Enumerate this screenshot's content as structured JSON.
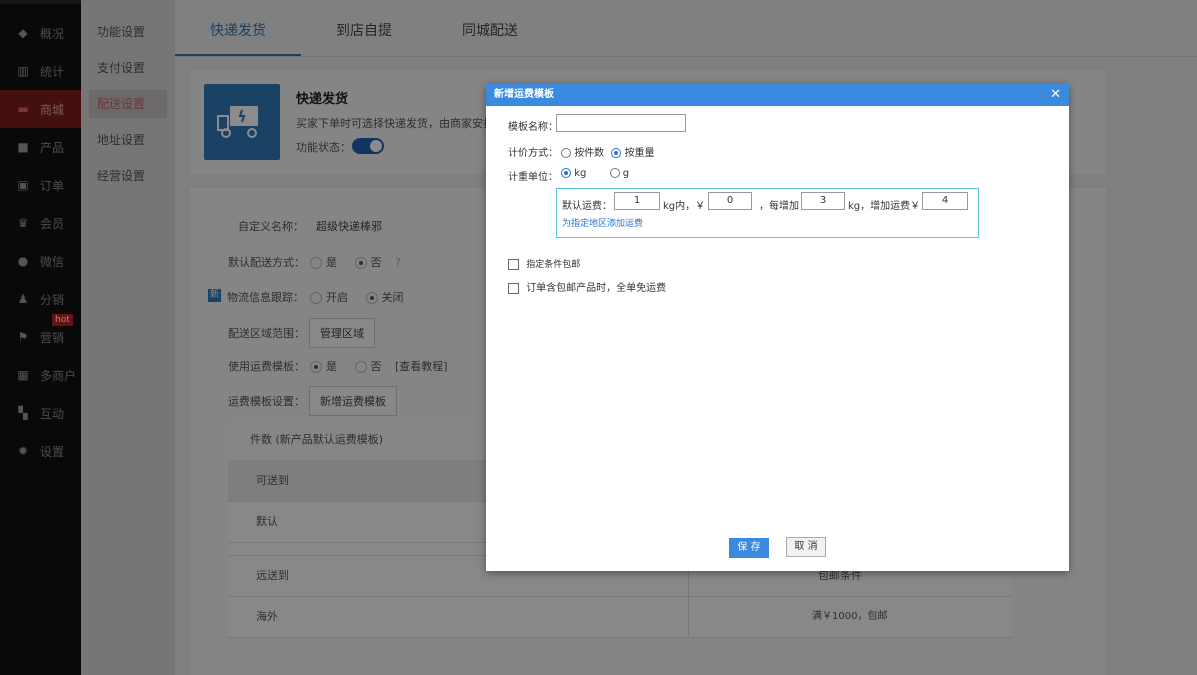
{
  "sidebar": {
    "items": [
      {
        "label": "概况",
        "icon": "graduation-icon"
      },
      {
        "label": "统计",
        "icon": "chart-icon"
      },
      {
        "label": "商城",
        "icon": "store-icon"
      },
      {
        "label": "产品",
        "icon": "grid-icon"
      },
      {
        "label": "订单",
        "icon": "order-icon"
      },
      {
        "label": "会员",
        "icon": "crown-icon"
      },
      {
        "label": "微信",
        "icon": "wechat-icon"
      },
      {
        "label": "分销",
        "icon": "users-icon"
      },
      {
        "label": "营销",
        "icon": "flag-icon",
        "badge": "hot"
      },
      {
        "label": "多商户",
        "icon": "merchant-icon"
      },
      {
        "label": "互动",
        "icon": "interact-icon"
      },
      {
        "label": "设置",
        "icon": "gear-icon"
      }
    ]
  },
  "subnav": {
    "items": [
      "功能设置",
      "支付设置",
      "配送设置",
      "地址设置",
      "经营设置"
    ]
  },
  "tabs": [
    "快递发货",
    "到店自提",
    "同城配送"
  ],
  "express": {
    "title": "快递发货",
    "desc": "买家下单时可选择快递发货，由商家安排",
    "status_label": "功能状态："
  },
  "form": {
    "custom_name_label": "自定义名称：",
    "custom_name_value": "超级快递棒邪",
    "default_method_label": "默认配送方式：",
    "yes": "是",
    "no": "否",
    "tracking_badge": "新",
    "tracking_label": "物流信息跟踪：",
    "open": "开启",
    "close": "关闭",
    "area_label": "配送区域范围：",
    "area_button": "管理区域",
    "use_template_label": "使用运费模板：",
    "tutorial_link": "[查看教程]",
    "template_setting_label": "运费模板设置：",
    "add_template_button": "新增运费模板"
  },
  "table": {
    "header": "件数 (新产品默认运费模板)",
    "rows": [
      {
        "left": "可送到",
        "right": ""
      },
      {
        "left": "默认",
        "right": ""
      },
      {
        "left": "远送到",
        "right": "包邮条件"
      },
      {
        "left": "海外",
        "right": "满￥1000，包邮"
      }
    ]
  },
  "modal": {
    "title": "新增运费模板",
    "name_label": "模板名称：",
    "pricing_label": "计价方式：",
    "by_count": "按件数",
    "by_weight": "按重量",
    "unit_label": "计重单位：",
    "unit_kg": "kg",
    "unit_g": "g",
    "default_fee_label": "默认运费：",
    "first_weight": "1",
    "within_text": "kg内，￥",
    "first_fee": "0",
    "per_add_text": "，每增加",
    "add_weight": "3",
    "add_fee_text": "kg，增加运费￥",
    "add_fee": "4",
    "region_link": "为指定地区添加运费",
    "free_shipping_option": "指定条件包邮",
    "order_free_option": "订单含包邮产品时，全单免运费",
    "save_label": "保 存",
    "cancel_label": "取 消"
  }
}
